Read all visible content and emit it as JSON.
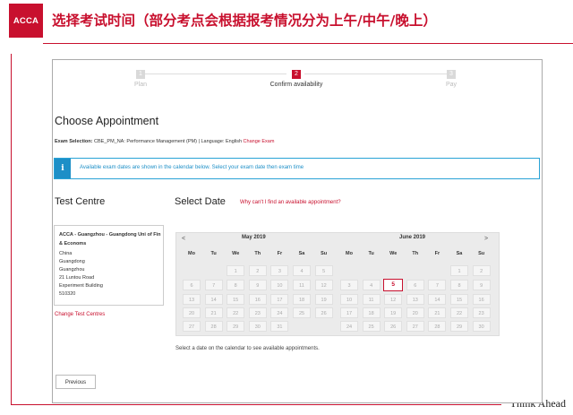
{
  "slide": {
    "logo": "ACCA",
    "title": "选择考试时间（部分考点会根据报考情况分为上午/中午/晚上）",
    "footer": "Think Ahead"
  },
  "steps": [
    {
      "num": "1",
      "label": "Plan"
    },
    {
      "num": "2",
      "label": "Confirm availability"
    },
    {
      "num": "3",
      "label": "Pay"
    }
  ],
  "choose": {
    "heading": "Choose Appointment",
    "exam_selection_label": "Exam Selection:",
    "exam_selection_value": "CBE_PM_NA: Performance Management (PM) | Language: English",
    "change_exam": "Change Exam"
  },
  "info": {
    "icon": "i",
    "text": "Available exam dates are shown in the calendar below. Select your exam date then exam time"
  },
  "test_centre": {
    "heading": "Test Centre",
    "name": "ACCA - Guangzhou - Guangdong Uni of Fin & Economs",
    "address": [
      "China",
      "Guangdong",
      "Guangzhou",
      "21 Luntou Road",
      "Experiment Building",
      "510320"
    ],
    "change_link": "Change Test Centres"
  },
  "select_date": {
    "heading": "Select Date",
    "why_link": "Why can't I find an available appointment?",
    "hint": "Select a date on the calendar to see available appointments."
  },
  "calendar": {
    "prev": "<",
    "next": ">",
    "weekdays": [
      "Mo",
      "Tu",
      "We",
      "Th",
      "Fr",
      "Sa",
      "Su"
    ],
    "months": [
      {
        "title": "May 2019",
        "rows": [
          [
            "",
            "",
            "1",
            "2",
            "3",
            "4",
            "5"
          ],
          [
            "6",
            "7",
            "8",
            "9",
            "10",
            "11",
            "12"
          ],
          [
            "13",
            "14",
            "15",
            "16",
            "17",
            "18",
            "19"
          ],
          [
            "20",
            "21",
            "22",
            "23",
            "24",
            "25",
            "26"
          ],
          [
            "27",
            "28",
            "29",
            "30",
            "31",
            "",
            ""
          ]
        ]
      },
      {
        "title": "June 2019",
        "rows": [
          [
            "",
            "",
            "",
            "",
            "",
            "1",
            "2"
          ],
          [
            "3",
            "4",
            "5",
            "6",
            "7",
            "8",
            "9"
          ],
          [
            "10",
            "11",
            "12",
            "13",
            "14",
            "15",
            "16"
          ],
          [
            "17",
            "18",
            "19",
            "20",
            "21",
            "22",
            "23"
          ],
          [
            "24",
            "25",
            "26",
            "27",
            "28",
            "29",
            "30"
          ]
        ],
        "selected": "5"
      }
    ]
  },
  "buttons": {
    "previous": "Previous"
  }
}
